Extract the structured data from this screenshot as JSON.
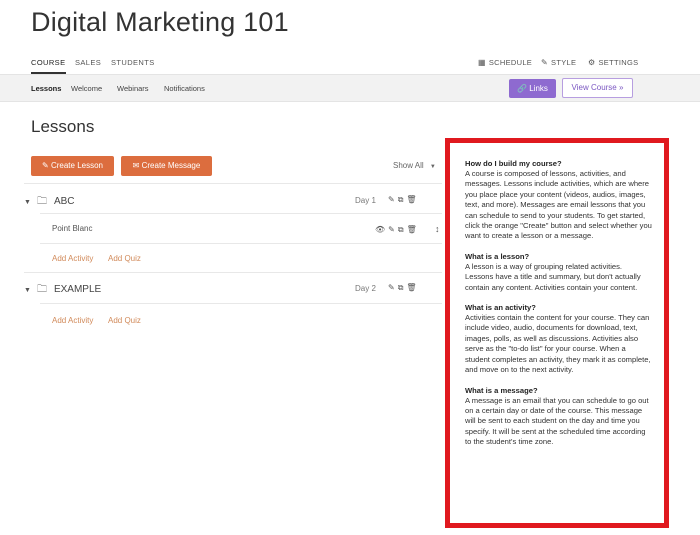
{
  "header": {
    "title": "Digital Marketing 101"
  },
  "topnav": {
    "tabs": [
      {
        "label": "COURSE",
        "active": true
      },
      {
        "label": "SALES",
        "active": false
      },
      {
        "label": "STUDENTS",
        "active": false
      }
    ],
    "right": [
      {
        "label": "SCHEDULE",
        "icon": "calendar-icon"
      },
      {
        "label": "STYLE",
        "icon": "brush-icon"
      },
      {
        "label": "SETTINGS",
        "icon": "gear-icon"
      }
    ]
  },
  "subnav": {
    "items": [
      {
        "label": "Lessons",
        "active": true
      },
      {
        "label": "Welcome",
        "active": false
      },
      {
        "label": "Webinars",
        "active": false
      },
      {
        "label": "Notifications",
        "active": false
      }
    ],
    "links_button": "Links",
    "view_course_button": "View Course »"
  },
  "main": {
    "title": "Lessons",
    "create_lesson": "Create Lesson",
    "create_message": "Create Message",
    "show_all": "Show All",
    "lessons": [
      {
        "name": "ABC",
        "day": "Day 1",
        "activities": [
          "Point Blanc"
        ],
        "add_activity": "Add Activity",
        "add_quiz": "Add Quiz"
      },
      {
        "name": "EXAMPLE",
        "day": "Day 2",
        "activities": [],
        "add_activity": "Add Activity",
        "add_quiz": "Add Quiz"
      }
    ]
  },
  "help": {
    "sections": [
      {
        "q": "How do I build my course?",
        "a": "A course is composed of lessons, activities, and messages. Lessons include activities, which are where you place place your content (videos, audios, images, text, and more). Messages are email lessons that you can schedule to send to your students. To get started, click the orange \"Create\" button and select whether you want to create a lesson or a message."
      },
      {
        "q": "What is a lesson?",
        "a": "A lesson is a way of grouping related activities. Lessons have a title and summary, but don't actually contain any content. Activities contain your content."
      },
      {
        "q": "What is an activity?",
        "a": "Activities contain the content for your course. They can include video, audio, documents for download, text, images, polls, as well as discussions. Activities also serve as the \"to-do list\" for your course. When a student completes an activity, they mark it as complete, and move on to the next activity."
      },
      {
        "q": "What is a message?",
        "a": "A message is an email that you can schedule to go out on a certain day or date of the course. This message will be sent to each student on the day and time you specify. It will be sent at the scheduled time according to the student's time zone."
      }
    ]
  },
  "colors": {
    "accent_orange": "#dc6d3e",
    "accent_purple": "#8e6ad0",
    "highlight_red": "#e0191f"
  }
}
